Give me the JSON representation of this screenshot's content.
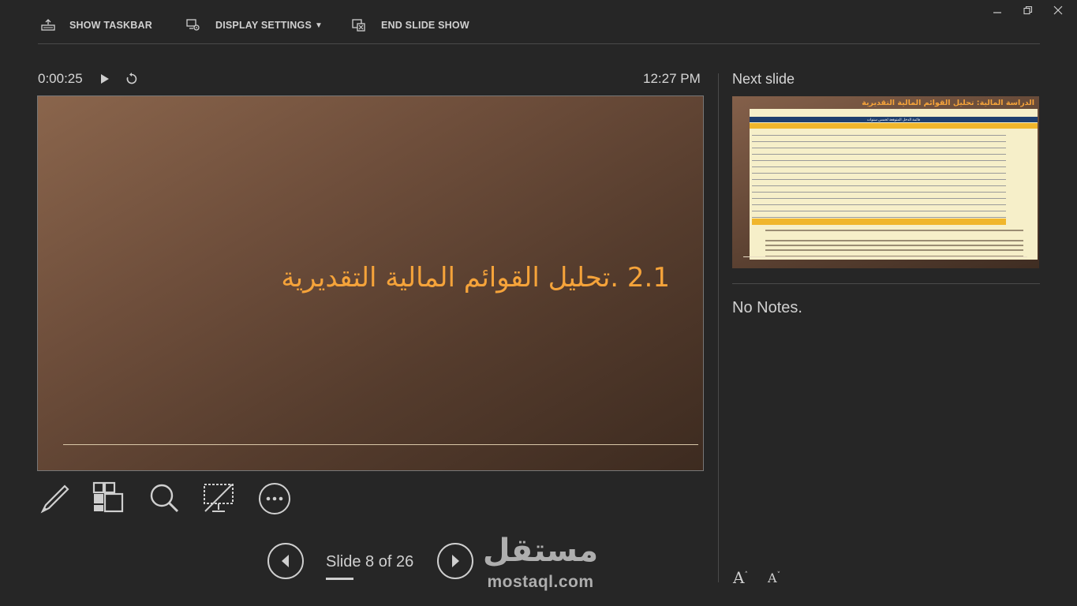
{
  "toolbar": {
    "show_taskbar": "SHOW TASKBAR",
    "display_settings": "DISPLAY SETTINGS",
    "end_slide_show": "END SLIDE SHOW"
  },
  "presenter": {
    "timer": "0:00:25",
    "clock": "12:27 PM"
  },
  "current_slide": {
    "title": "2.1 .تحليل القوائم المالية التقديرية"
  },
  "next_slide": {
    "label": "Next slide",
    "thumb_title": "الدراسة المالية: تحليل القوائم المالية التقديرية",
    "thumb_table_caption": "قائمة الدخل المتوقعة لخمس سنوات"
  },
  "notes": {
    "text": "No Notes."
  },
  "navigation": {
    "counter": "Slide 8 of 26"
  },
  "font_controls": {
    "increase": "A",
    "decrease": "A"
  },
  "watermark": {
    "arabic": "مستقل",
    "latin": "mostaql.com"
  },
  "colors": {
    "accent": "#f5a33a",
    "background": "#262626"
  }
}
